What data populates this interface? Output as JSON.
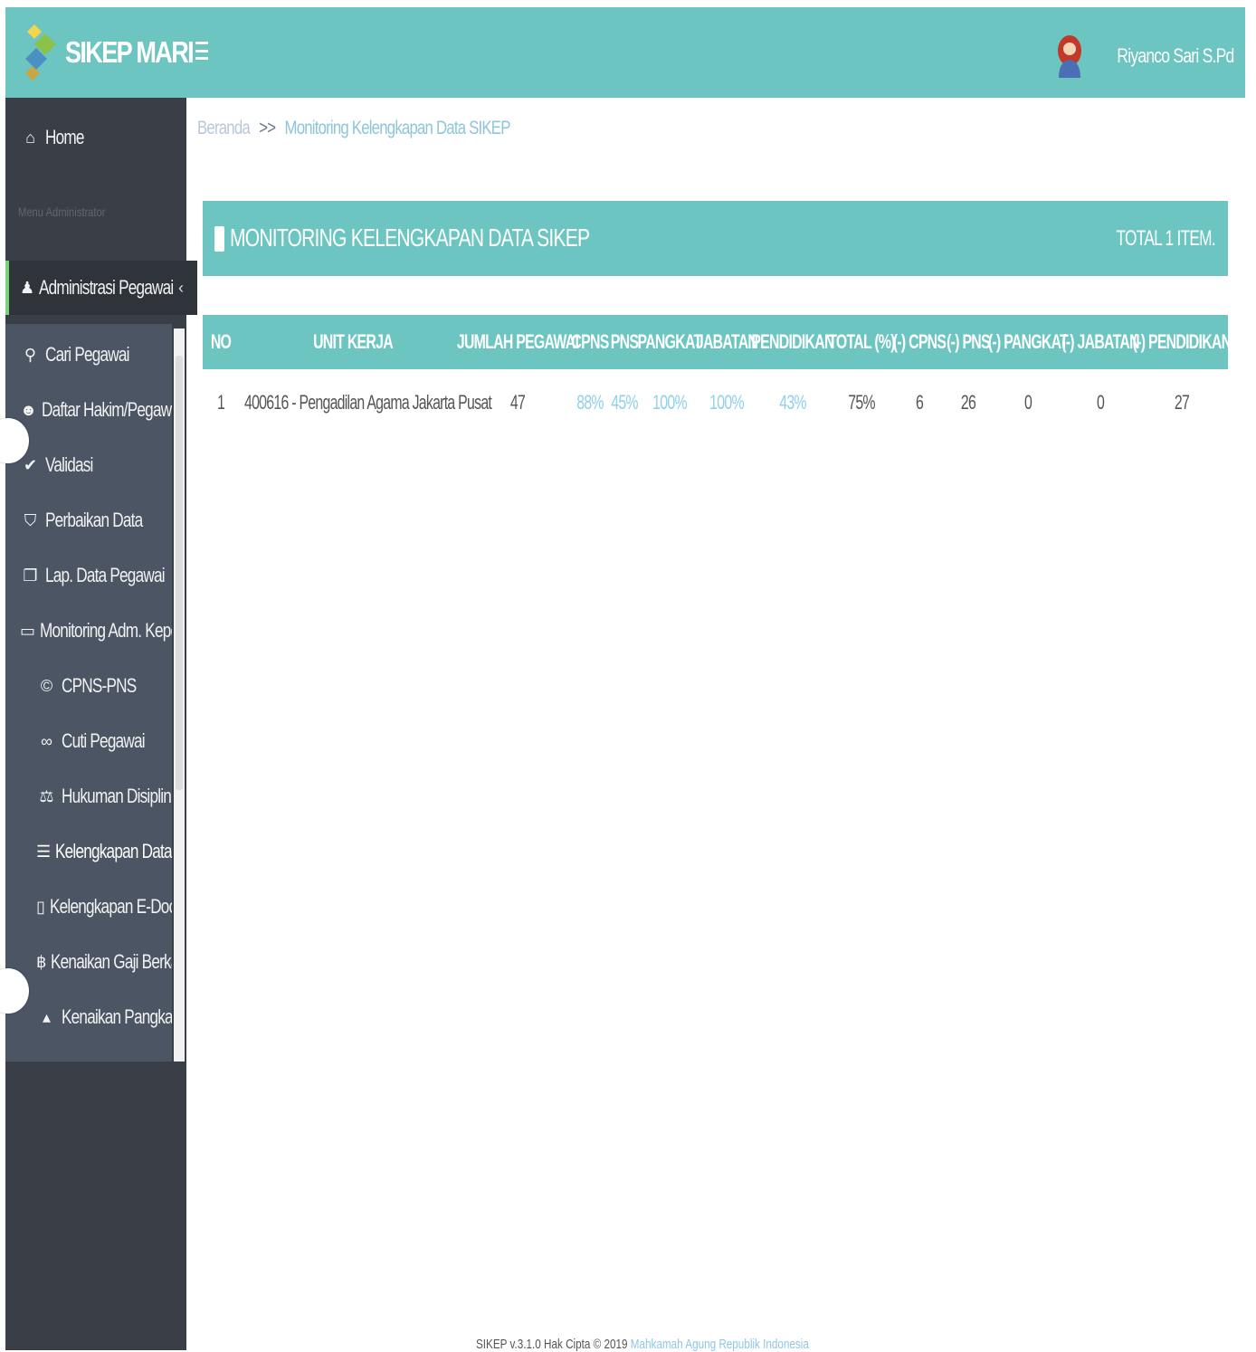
{
  "header": {
    "brand": "SIKEP MARI",
    "user_name": "Riyanco Sari S.Pd"
  },
  "sidebar": {
    "home": "Home",
    "menu_header": "Menu Administrator",
    "admin": "Administrasi Pegawai",
    "items": [
      {
        "label": "Cari Pegawai",
        "icon": "search-icon"
      },
      {
        "label": "Daftar Hakim/Pegawai",
        "icon": "users-icon"
      },
      {
        "label": "Validasi",
        "icon": "check-icon"
      },
      {
        "label": "Perbaikan Data",
        "icon": "shield-check-icon"
      },
      {
        "label": "Lap. Data Pegawai",
        "icon": "copy-icon"
      },
      {
        "label": "Monitoring Adm. Kepeg.",
        "icon": "monitor-icon"
      },
      {
        "label": "CPNS-PNS",
        "icon": "copyright-icon"
      },
      {
        "label": "Cuti Pegawai",
        "icon": "binoculars-icon"
      },
      {
        "label": "Hukuman Disiplin",
        "icon": "balance-scale-icon"
      },
      {
        "label": "Kelengkapan Data SIKEP",
        "icon": "database-icon"
      },
      {
        "label": "Kelengkapan E-Doc SIKEP",
        "icon": "file-pdf-icon"
      },
      {
        "label": "Kenaikan Gaji Berkala",
        "icon": "bitcoin-icon"
      },
      {
        "label": "Kenaikan Pangkat",
        "icon": "caret-up-icon"
      }
    ]
  },
  "breadcrumb": {
    "home": "Beranda",
    "separator": ">>",
    "current": "Monitoring Kelengkapan Data SIKEP"
  },
  "panel": {
    "title": "MONITORING KELENGKAPAN DATA SIKEP",
    "total": "TOTAL 1 ITEM."
  },
  "table": {
    "headers": [
      "NO",
      "UNIT KERJA",
      "JUMLAH PEGAWAI",
      "CPNS",
      "PNS",
      "PANGKAT",
      "JABATAN",
      "PENDIDIKAN",
      "TOTAL (%)",
      "(-) CPNS",
      "(-) PNS",
      "(-) PANGKAT",
      "(-) JABATAN",
      "(-) PENDIDIKAN"
    ],
    "rows": [
      [
        "1",
        "400616 - Pengadilan Agama Jakarta Pusat",
        "47",
        "88%",
        "45%",
        "100%",
        "100%",
        "43%",
        "75%",
        "6",
        "26",
        "0",
        "0",
        "27"
      ]
    ]
  },
  "footer": {
    "text": "SIKEP v.3.1.0 Hak Cipta © 2019 ",
    "org": "Mahkamah Agung Republik Indonesia"
  },
  "colors": {
    "accent": "#6cc5c0",
    "sidebar": "#3a3f47",
    "submenu": "#4b5563",
    "link": "#8fd0ea"
  }
}
